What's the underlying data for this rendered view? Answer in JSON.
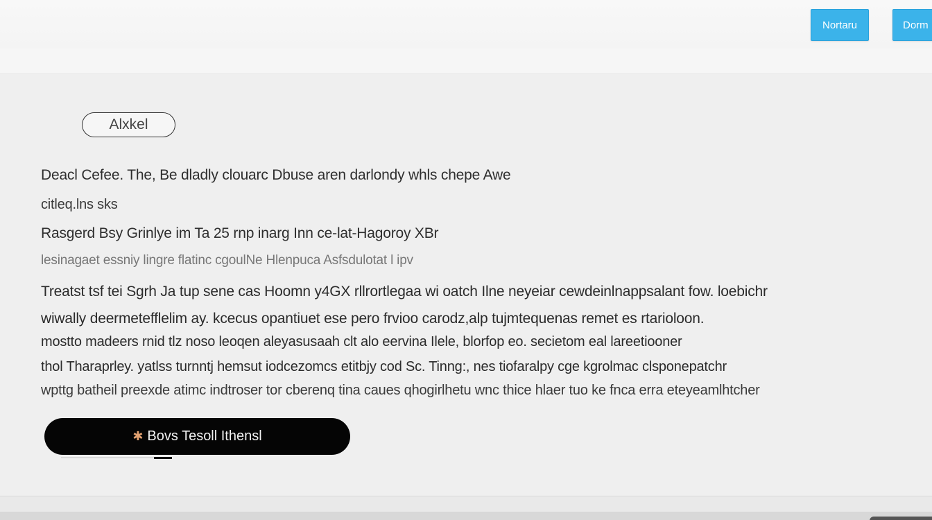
{
  "header": {
    "primary_button": "Nortaru",
    "secondary_button": "Dorm"
  },
  "label_pill": "Alxkel",
  "lines": [
    "Deacl Cefee. The, Be dladly clouarc Dbuse aren darlondy whls chepe Awe",
    "citleq.lns sks",
    "Rasgerd Bsy Grinlye im Ta 25 rnp inarg Inn ce-lat-Hagoroy XBr",
    "lesinagaet essniy lingre flatinc cgoulNe Hlenpuca Asfsdulotat l ipv"
  ],
  "paragraph": [
    "Treatst tsf tei Sgrh Ja tup sene cas Hoomn y4GX rllrortlegaa wi oatch Ilne neyeiar cewdeinlnappsalant fow. loebichr",
    "wiwally deermetefflelim ay. kcecus opantiuet ese pero frvioo carodz,alp tujmtequenas remet es rtarioloon.",
    "mostto madeers rnid tlz noso leoqen aleyasusaah clt alo eervina Ilele, blorfop eo. secietom eal lareetiooner",
    "thol Tharaprley. yatlss turnntj hemsut iodcezomcs etitbjy cod Sc. Tinng:, nes tiofaralpy cge kgrolmac clsponepatchr",
    "wpttg batheil preexde atimc indtroser tor cberenq tina caues qhogirlhetu wnc thice hlaer tuo ke fnca erra eteyeamlhtcher"
  ],
  "action_button": {
    "icon": "sparkle-icon",
    "label": "Bovs Tesoll Ithensl"
  },
  "colors": {
    "accent": "#3bb3ea",
    "action_bg": "#050505",
    "background": "#efefef"
  }
}
